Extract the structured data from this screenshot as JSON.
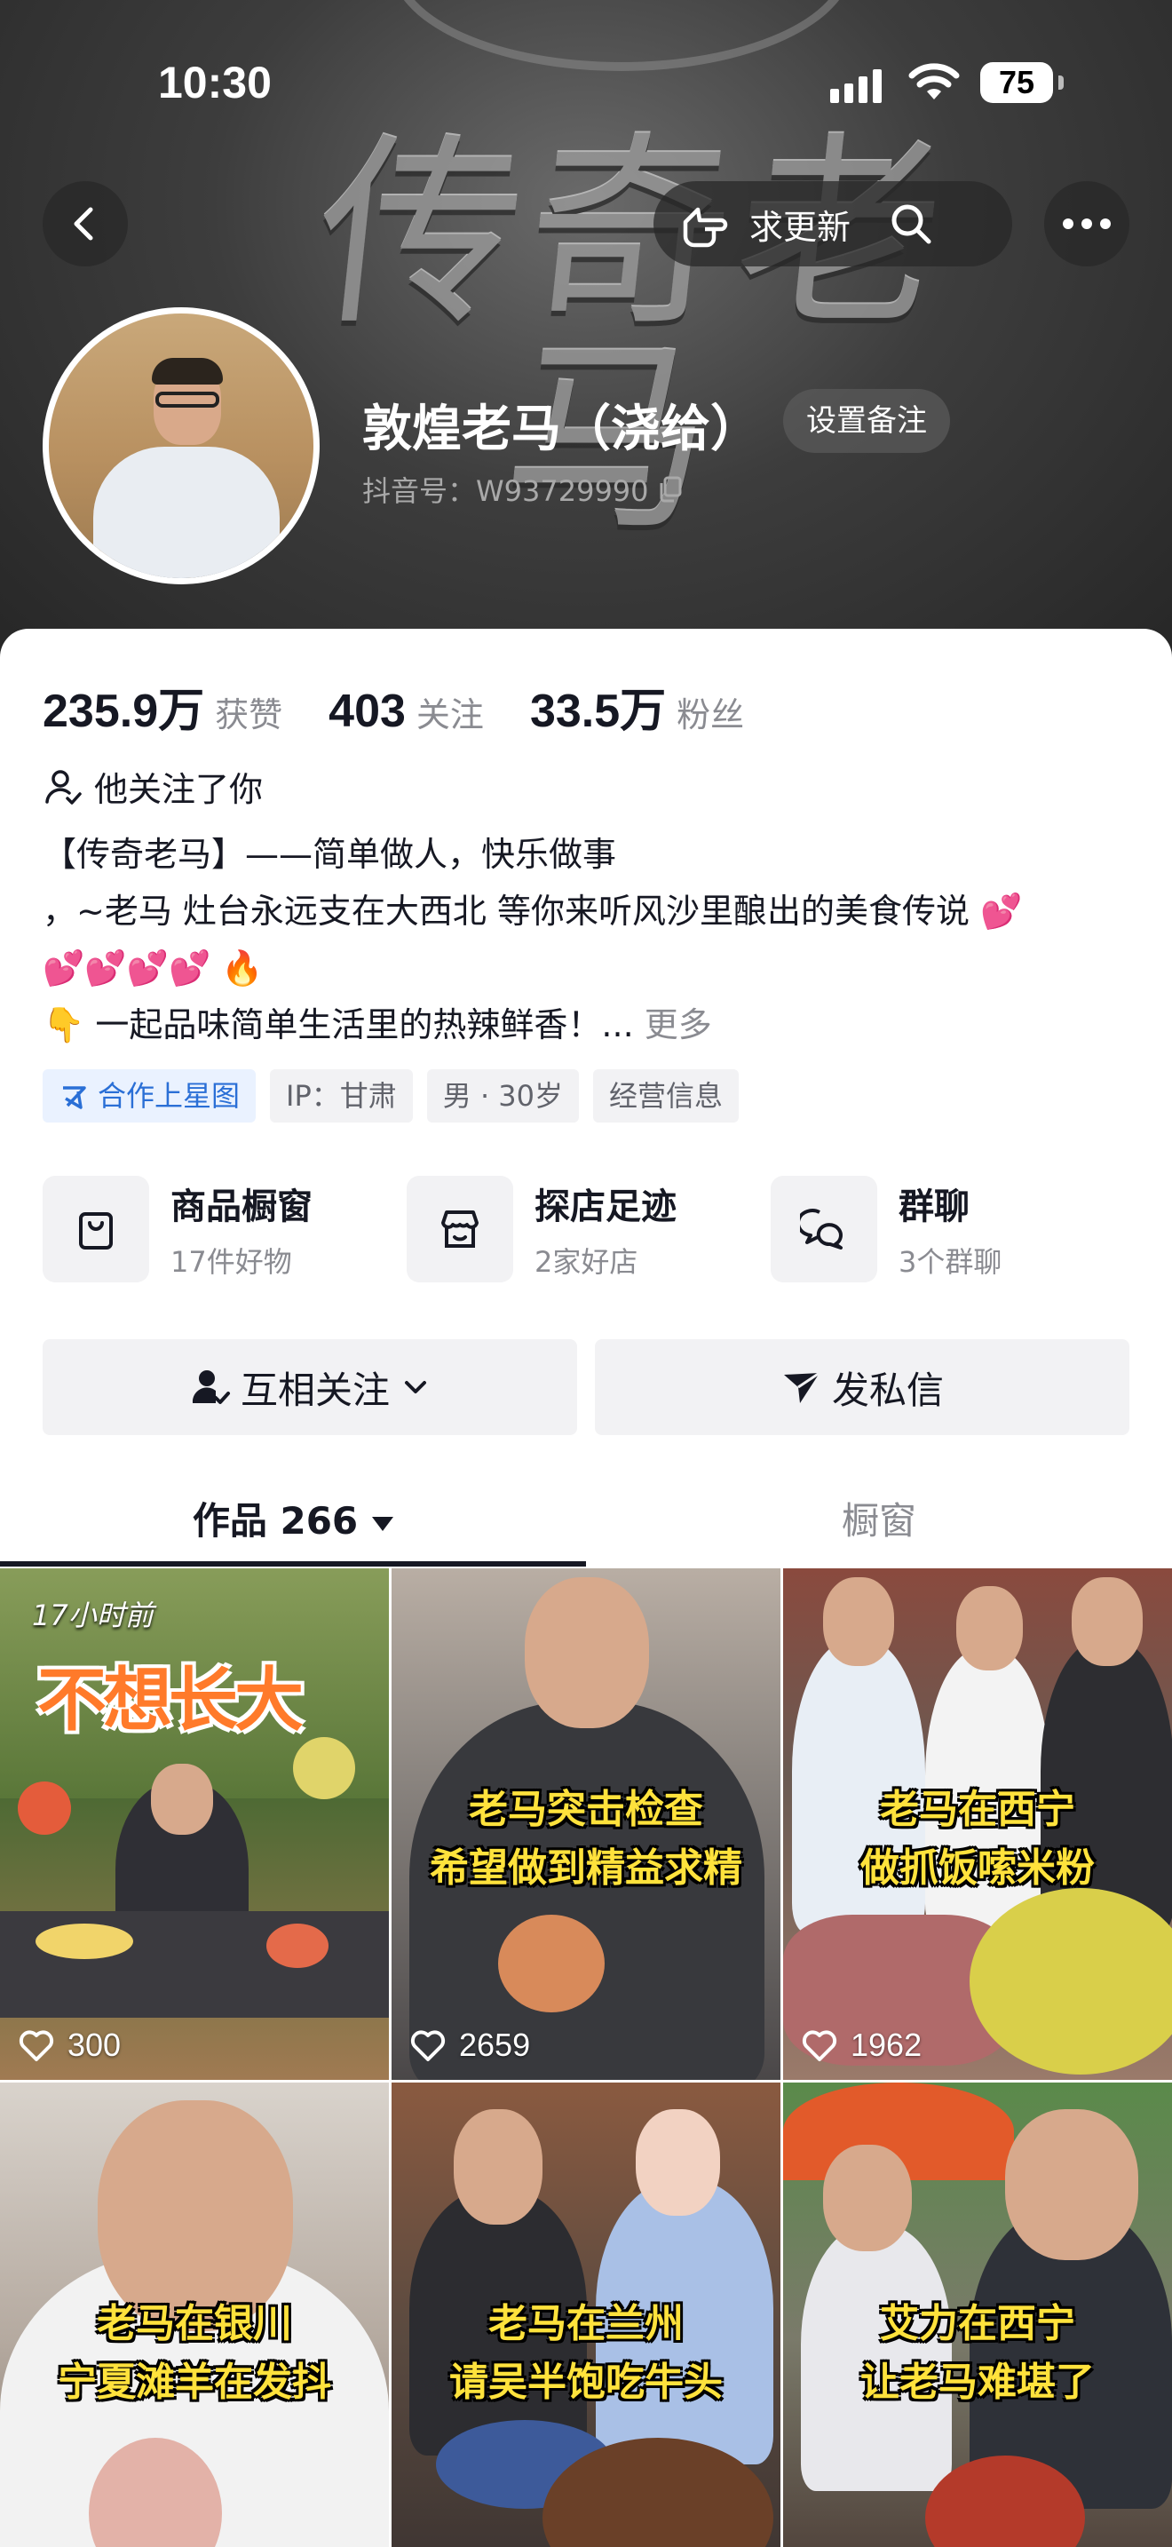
{
  "status_bar": {
    "time": "10:30",
    "battery": "75"
  },
  "cover": {
    "title": "传奇老马"
  },
  "header": {
    "back_label": "返回",
    "request_update": "求更新",
    "set_remark": "设置备注"
  },
  "profile": {
    "name": "敦煌老马（浇给）",
    "douyin_id": "抖音号：W93729990"
  },
  "stats": [
    {
      "value": "235.9万",
      "label": "获赞"
    },
    {
      "value": "403",
      "label": "关注"
    },
    {
      "value": "33.5万",
      "label": "粉丝"
    }
  ],
  "follows_you": "他关注了你",
  "bio": {
    "line1": "【传奇老马】——简单做人，快乐做事",
    "line2": "，~老马 灶台永远支在大西北 等你来听风沙里酿出的美食传说",
    "line2_emoji": "💕",
    "line3_hearts": "💕💕💕💕",
    "line3_fire": "🔥",
    "line4_pointer": "👇",
    "line4_text": "一起品味简单生活里的热辣鲜香！... ",
    "more": "更多"
  },
  "tags": {
    "star": "合作上星图",
    "ip": "IP：甘肃",
    "gender_age": "男 · 30岁",
    "business": "经营信息"
  },
  "features": [
    {
      "title": "商品橱窗",
      "sub": "17件好物"
    },
    {
      "title": "探店足迹",
      "sub": "2家好店"
    },
    {
      "title": "群聊",
      "sub": "3个群聊"
    }
  ],
  "actions": {
    "mutual_follow": "互相关注",
    "message": "发私信"
  },
  "tabs": {
    "works": "作品 266",
    "showcase": "橱窗"
  },
  "videos": [
    {
      "time_ago": "17小时前",
      "title": "不想长大",
      "likes": "300"
    },
    {
      "caption1": "老马突击检查",
      "caption2": "希望做到精益求精",
      "likes": "2659"
    },
    {
      "caption1": "老马在西宁",
      "caption2": "做抓饭嗦米粉",
      "likes": "1962"
    },
    {
      "caption1": "老马在银川",
      "caption2": "宁夏滩羊在发抖"
    },
    {
      "caption1": "老马在兰州",
      "caption2": "请吴半饱吃牛头"
    },
    {
      "caption1": "艾力在西宁",
      "caption2": "让老马难堪了"
    }
  ],
  "colors": {
    "primary_text": "#161823",
    "secondary_text": "#8a8b91",
    "caption_yellow": "#ffe23c",
    "star_blue": "#2a6fd6"
  }
}
